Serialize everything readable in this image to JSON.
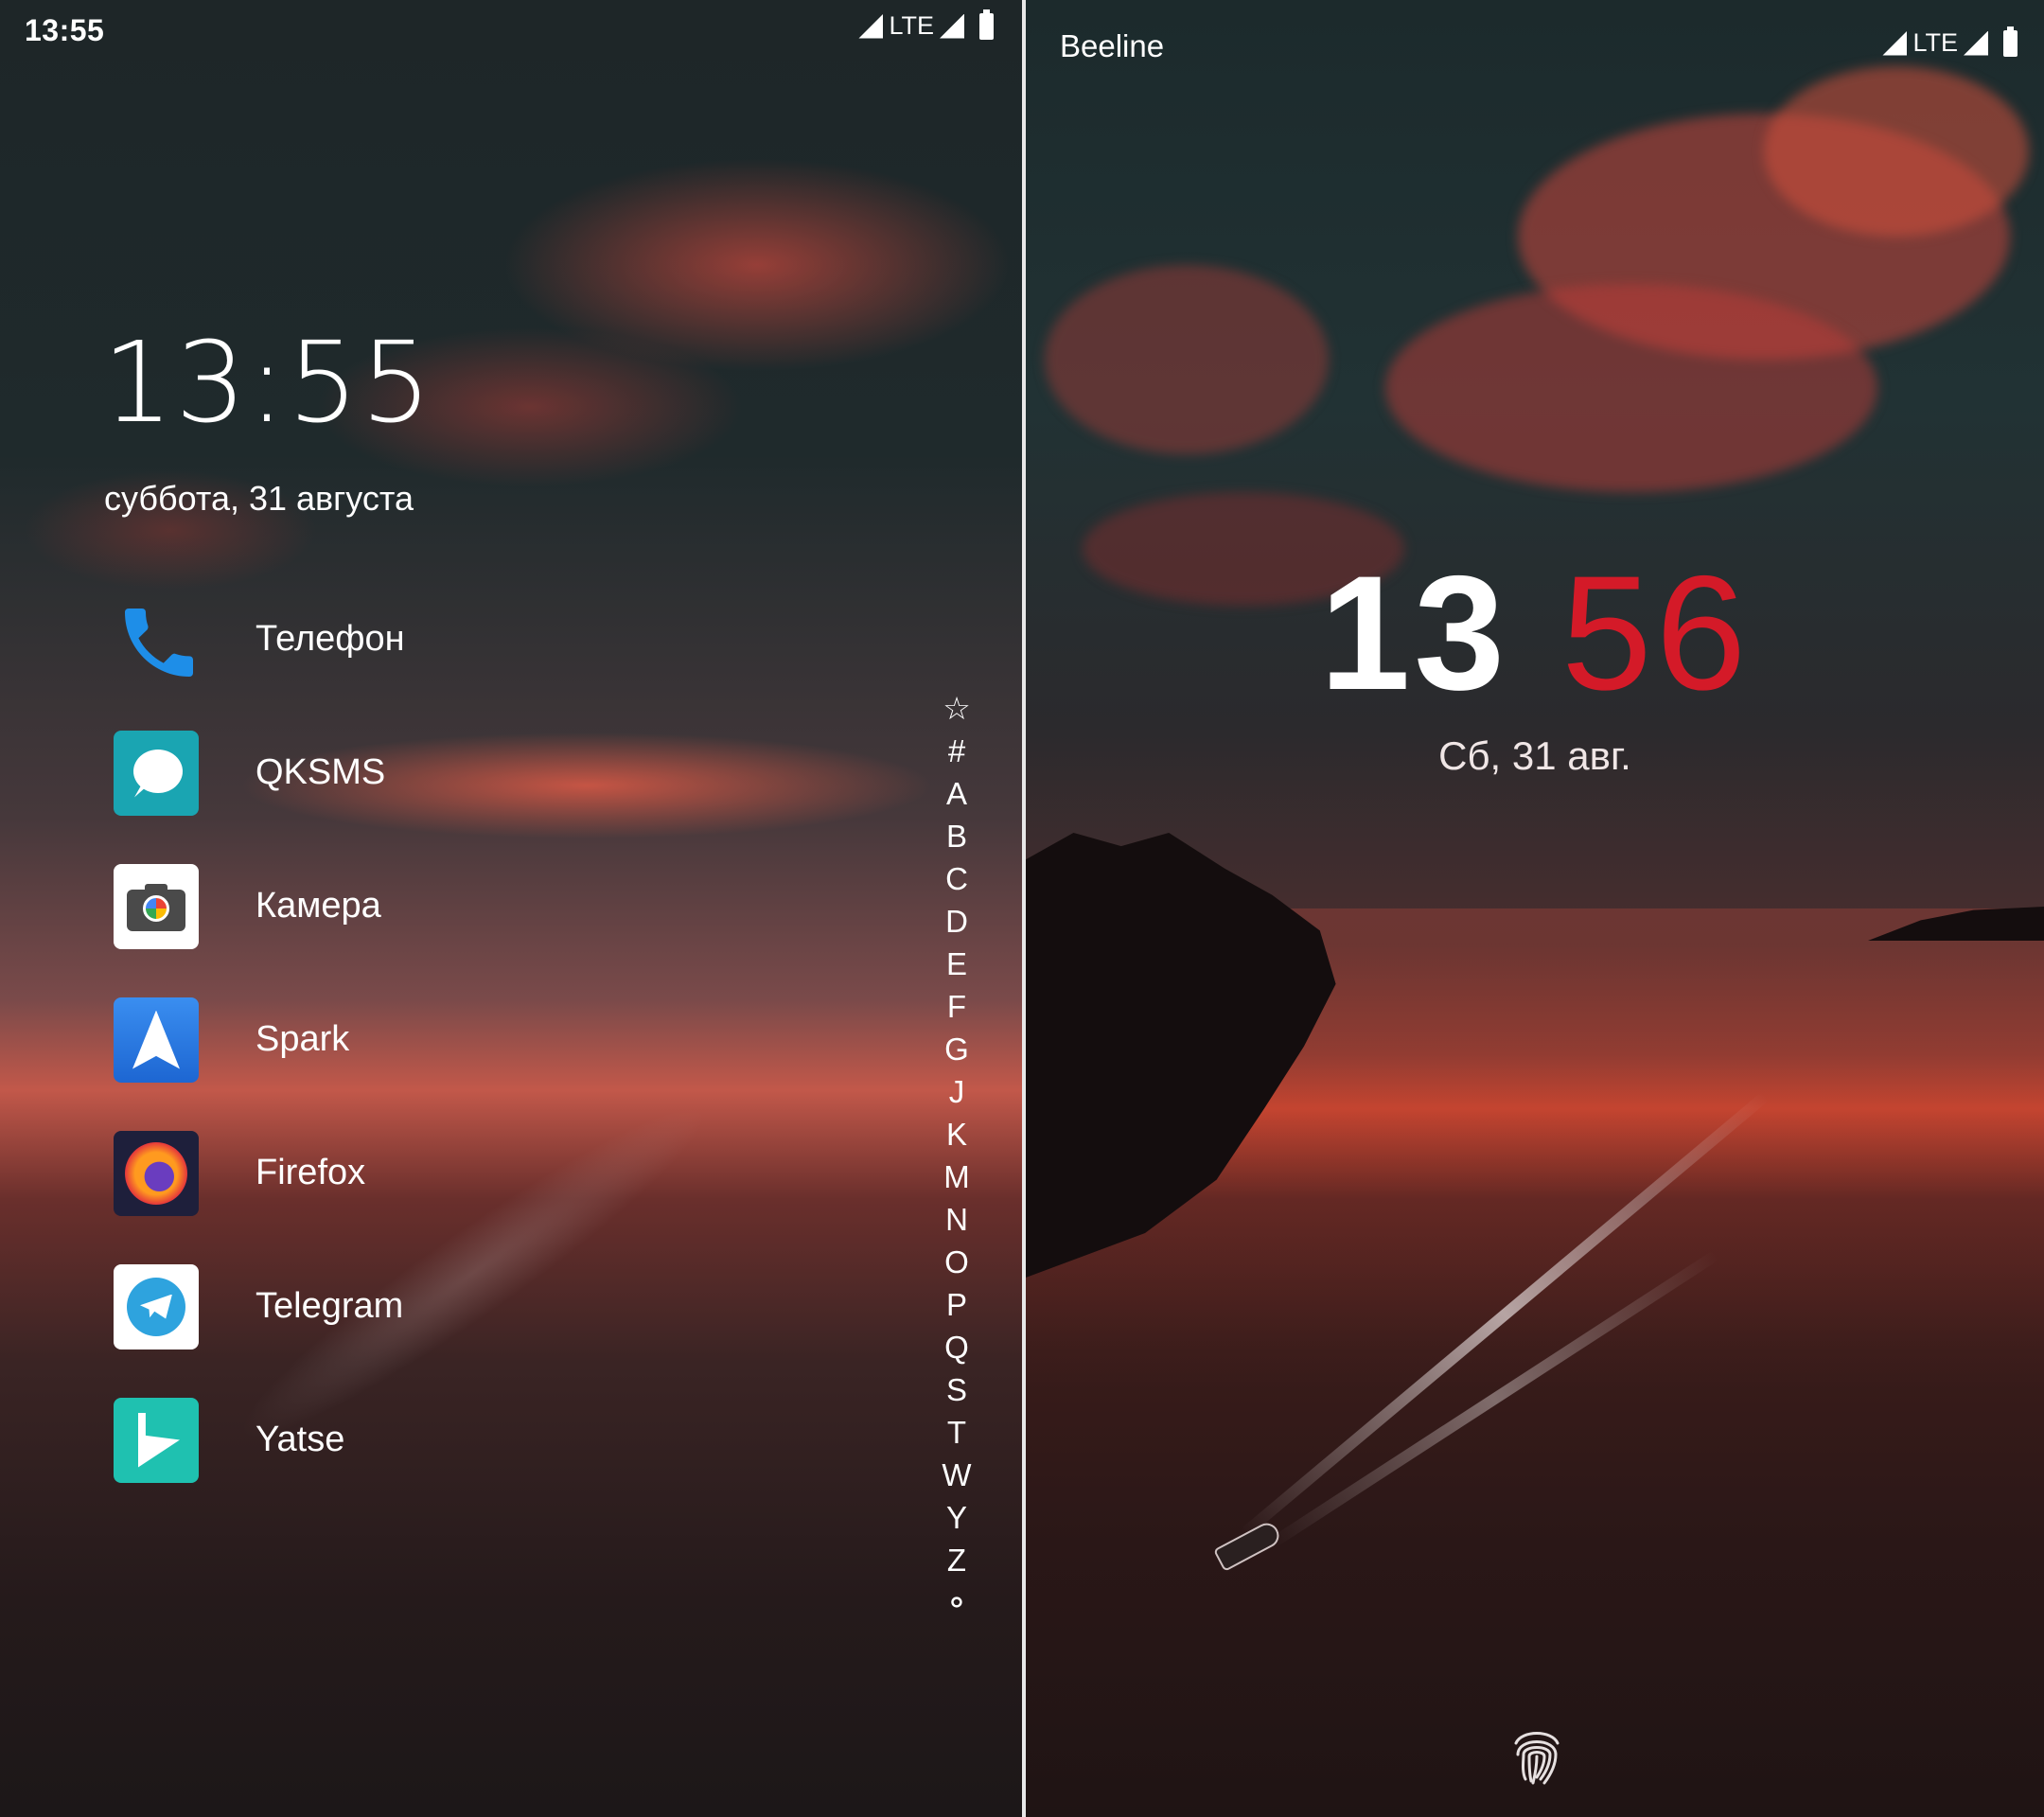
{
  "left": {
    "status_time": "13:55",
    "network": "LTE",
    "clock": "13:55",
    "date": "суббота, 31 августа",
    "apps": [
      {
        "label": "Телефон",
        "icon": "phone-icon"
      },
      {
        "label": "QKSMS",
        "icon": "chat-bubble-icon"
      },
      {
        "label": "Камера",
        "icon": "camera-icon"
      },
      {
        "label": "Spark",
        "icon": "paper-plane-icon"
      },
      {
        "label": "Firefox",
        "icon": "firefox-icon"
      },
      {
        "label": "Telegram",
        "icon": "telegram-icon"
      },
      {
        "label": "Yatse",
        "icon": "play-icon"
      }
    ],
    "alpha_index": [
      "☆",
      "#",
      "A",
      "B",
      "C",
      "D",
      "E",
      "F",
      "G",
      "J",
      "K",
      "M",
      "N",
      "O",
      "P",
      "Q",
      "S",
      "T",
      "W",
      "Y",
      "Z",
      "⚬"
    ]
  },
  "right": {
    "carrier": "Beeline",
    "network": "LTE",
    "clock_hours": "13",
    "clock_minutes": "56",
    "date": "Сб, 31 авг.",
    "minutes_color": "#d41a28",
    "fingerprint": "fingerprint-icon"
  }
}
